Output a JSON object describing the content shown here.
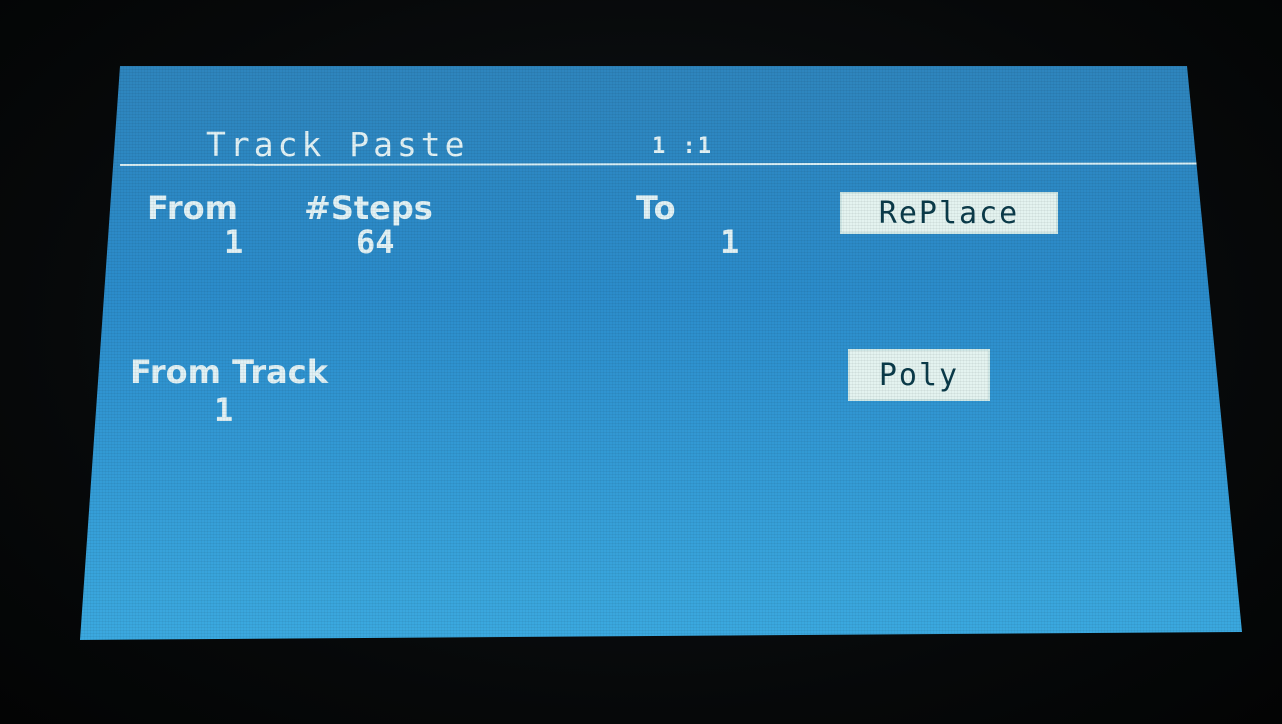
{
  "header": {
    "title": "Track Paste",
    "position": "1 :1"
  },
  "fields": {
    "from_label": "From",
    "from_value": "1",
    "steps_label": "#Steps",
    "steps_value": "64",
    "to_label": "To",
    "to_value": "1",
    "from_track_label": "From Track",
    "from_track_value": "1"
  },
  "buttons": {
    "mode_label": "RePlace",
    "poly_label": "Poly"
  },
  "colors": {
    "screen_blue": "#2b8ccb",
    "text": "#e2f2f6",
    "button_bg": "#e4f3f0",
    "button_text": "#0b3b4a"
  }
}
